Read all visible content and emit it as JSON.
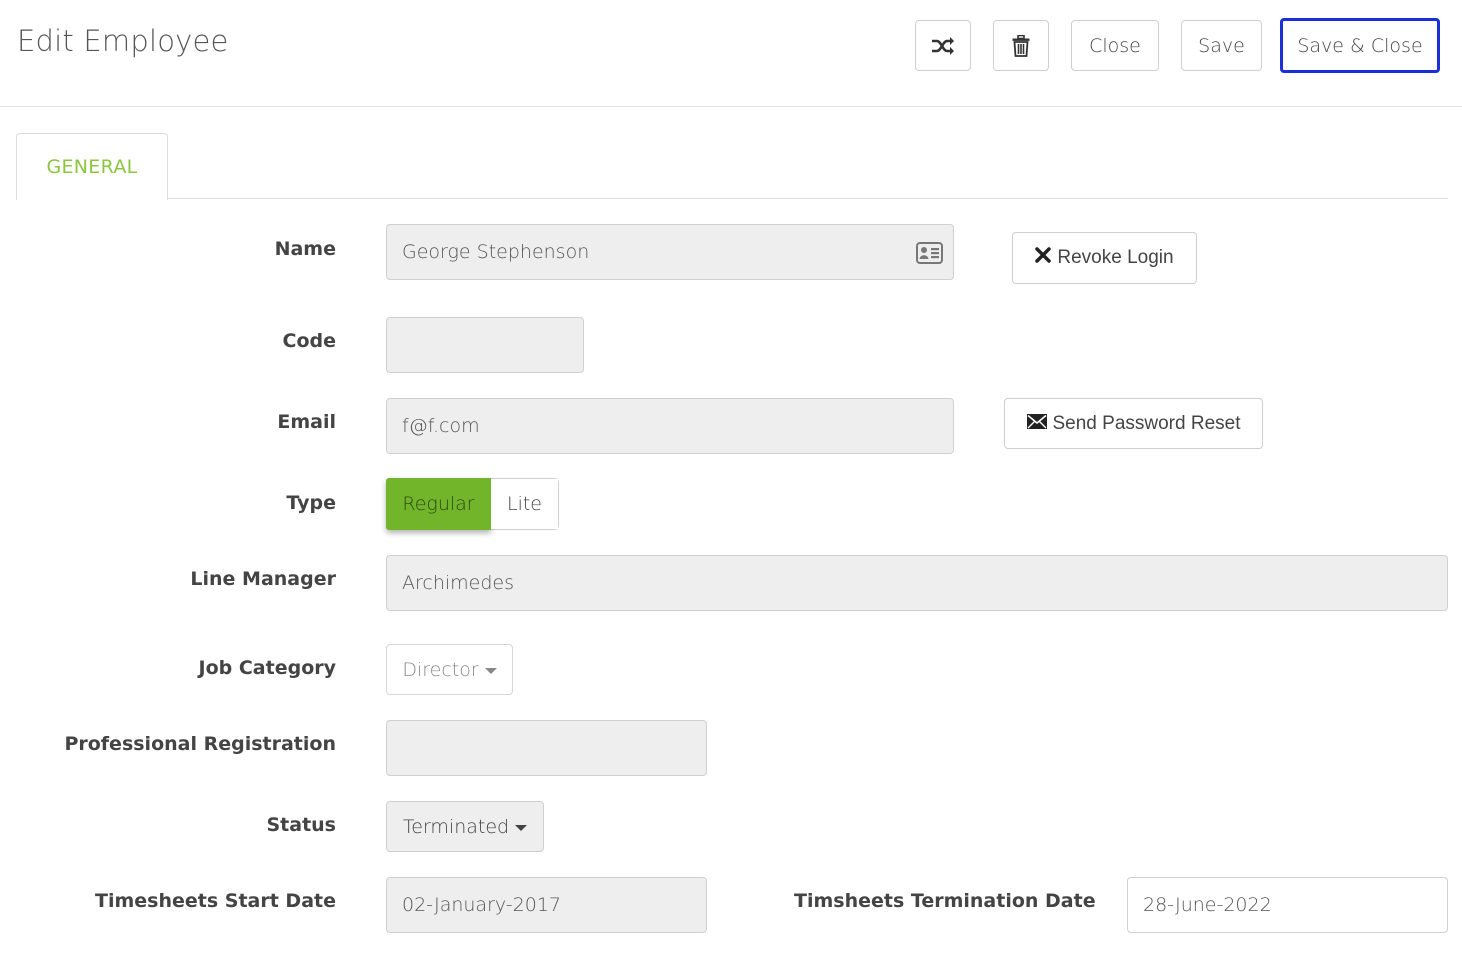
{
  "header": {
    "title": "Edit Employee",
    "close_label": "Close",
    "save_label": "Save",
    "save_close_label": "Save & Close",
    "focus_color": "#1a2fd8"
  },
  "tabs": [
    {
      "label": "GENERAL",
      "active": true,
      "color": "#8cc63f"
    }
  ],
  "form": {
    "name": {
      "label": "Name",
      "value": "George Stephenson"
    },
    "revoke_login_label": "Revoke Login",
    "code": {
      "label": "Code",
      "value": ""
    },
    "email": {
      "label": "Email",
      "value": "f@f.com"
    },
    "send_password_reset_label": "Send Password Reset",
    "type": {
      "label": "Type",
      "options": [
        "Regular",
        "Lite"
      ],
      "selected": "Regular",
      "active_color": "#72b52b"
    },
    "line_manager": {
      "label": "Line Manager",
      "value": "Archimedes"
    },
    "job_category": {
      "label": "Job Category",
      "value": "Director"
    },
    "professional_registration": {
      "label": "Professional Registration",
      "value": ""
    },
    "status": {
      "label": "Status",
      "value": "Terminated"
    },
    "timesheets_start_date": {
      "label": "Timesheets Start Date",
      "value": "02-January-2017"
    },
    "timesheets_termination_date": {
      "label": "Timsheets Termination Date",
      "value": "28-June-2022"
    }
  },
  "icons": {
    "shuffle": "shuffle-icon",
    "delete": "trash-icon",
    "contact_card": "contact-card-icon",
    "revoke": "close-icon",
    "envelope": "envelope-icon"
  }
}
